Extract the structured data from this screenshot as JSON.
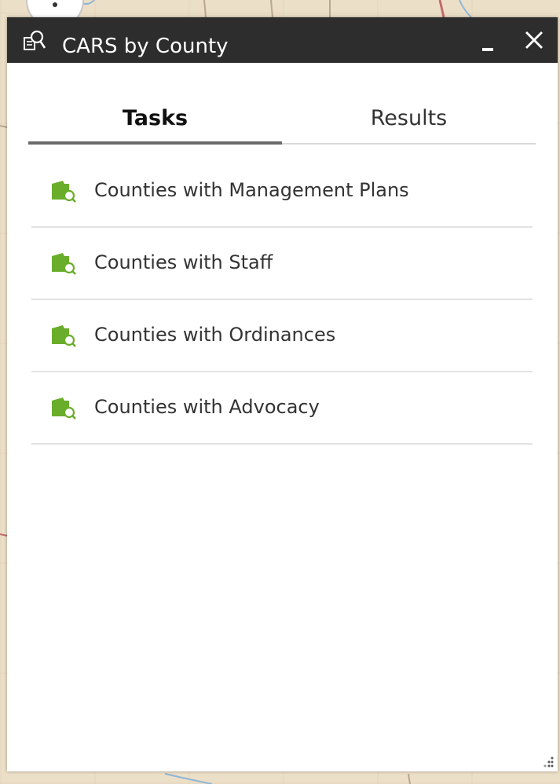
{
  "window": {
    "title": "CARS by County",
    "title_icon": "query-icon",
    "minimize_icon": "minimize-icon",
    "close_icon": "close-icon"
  },
  "tabs": [
    {
      "label": "Tasks",
      "active": true
    },
    {
      "label": "Results",
      "active": false
    }
  ],
  "tasks": [
    {
      "label": "Counties with Management Plans",
      "icon": "layer-search-icon"
    },
    {
      "label": "Counties with Staff",
      "icon": "layer-search-icon"
    },
    {
      "label": "Counties with Ordinances",
      "icon": "layer-search-icon"
    },
    {
      "label": "Counties with Advocacy",
      "icon": "layer-search-icon"
    }
  ],
  "colors": {
    "titlebar": "#2d2d2d",
    "task_icon_green": "#6aad2a",
    "tab_indicator": "#6b6b6b"
  }
}
